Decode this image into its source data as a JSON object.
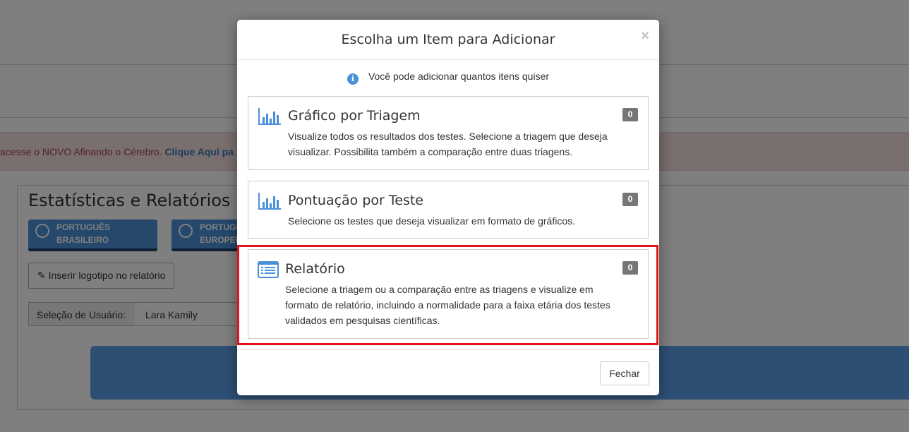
{
  "background": {
    "alert": {
      "text": "acesse o NOVO Afinando o Cérebro.",
      "link": "Clique Aqui pa"
    },
    "page_title": "Estatísticas e Relatórios",
    "language_buttons": [
      {
        "label": "PORTUGUÊS BRASILEIRO"
      },
      {
        "label": "PORTUGUÊS EUROPEU"
      }
    ],
    "logo_button": "✎ Inserir logotipo no relatório",
    "user_select": {
      "label": "Seleção de Usuário:",
      "value": "Lara Kamily"
    }
  },
  "modal": {
    "title": "Escolha um Item para Adicionar",
    "close_symbol": "×",
    "info_text": "Você pode adicionar quantos itens quiser",
    "items": [
      {
        "title": "Gráfico por Triagem",
        "description": "Visualize todos os resultados dos testes. Selecione a triagem que deseja visualizar. Possibilita também a comparação entre duas triagens.",
        "count": "0",
        "icon": "bar-chart-icon"
      },
      {
        "title": "Pontuação por Teste",
        "description": "Selecione os testes que deseja visualizar em formato de gráficos.",
        "count": "0",
        "icon": "bar-chart-icon"
      },
      {
        "title": "Relatório",
        "description": "Selecione a triagem ou a comparação entre as triagens e visualize em formato de relatório, incluindo a normalidade para a faixa etária dos testes validados em pesquisas científicas.",
        "count": "0",
        "icon": "list-report-icon"
      }
    ],
    "footer_button": "Fechar"
  },
  "colors": {
    "accent_blue": "#4a90d9",
    "highlight_red": "#e0141b",
    "badge_gray": "#777777"
  }
}
